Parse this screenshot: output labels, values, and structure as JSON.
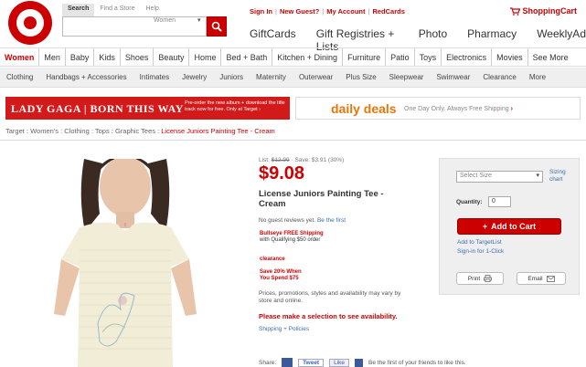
{
  "header": {
    "search_tabs": [
      "Search",
      "Find a Store",
      "Help"
    ],
    "search_placeholder": "",
    "search_scope": "Women",
    "top_links": [
      "Sign In",
      "New Guest?",
      "My Account",
      "RedCards"
    ],
    "cart_label": "ShoppingCart",
    "secondary_links": [
      "GiftCards",
      "Gift Registries + Lists",
      "Photo",
      "Pharmacy",
      "WeeklyAd"
    ]
  },
  "category_nav": {
    "items": [
      "Women",
      "Men",
      "Baby",
      "Kids",
      "Shoes",
      "Beauty",
      "Home",
      "Bed + Bath",
      "Kitchen + Dining",
      "Furniture",
      "Patio",
      "Toys",
      "Electronics",
      "Movies",
      "See More"
    ],
    "active": "Women"
  },
  "sub_nav": {
    "items": [
      "Clothing",
      "Handbags + Accessories",
      "Intimates",
      "Jewelry",
      "Juniors",
      "Maternity",
      "Outerwear",
      "Plus Size",
      "Sleepwear",
      "Swimwear",
      "Clearance",
      "More"
    ]
  },
  "banners": {
    "gaga_title": "LADY GAGA | BORN THIS WAY",
    "gaga_sub": "Pre-order the new album + download the title track now for free. Only at Target ›",
    "deals_title": "daily deals",
    "deals_sub": "One Day Only. Always Free Shipping",
    "deals_arrow": "›"
  },
  "breadcrumb": {
    "path": "Target : Women's : Clothing : Tops : Graphic Tees : ",
    "current": "License Juniors Painting Tee - Cream"
  },
  "product": {
    "list_label": "List: ",
    "list_price": "$12.99",
    "save_text": " · Save: $3.91 (30%)",
    "price": "$9.08",
    "title": "License Juniors Painting Tee - Cream",
    "reviews": "No guest reviews yet.",
    "reviews_link": "Be the first",
    "shipping_title": "Bullseye FREE Shipping",
    "shipping_sub": "with Qualifying $50 order",
    "clearance": "clearance",
    "save_offer_1": "Save 20% When",
    "save_offer_2": "You Spend $75",
    "disclaimer": "Prices, promotions, styles and availability may vary by store and online.",
    "select_msg": "Please make a selection to see availability.",
    "policies": "Shipping + Policies"
  },
  "share": {
    "label": "Share:",
    "tweet": "Tweet",
    "like": "Like",
    "like_text": "Be the first of your friends to like this."
  },
  "buybox": {
    "size_placeholder": "Select Size",
    "size_chart": "Sizing chart",
    "quantity_label": "Quantity:",
    "quantity_value": "0",
    "add_to_cart": "Add to Cart",
    "add_to_list": "Add to TargetList",
    "sign_in": "Sign-in for 1-Click",
    "print": "Print",
    "email": "Email"
  },
  "colors": {
    "brand_red": "#cc0000",
    "link_blue": "#3a6fb0"
  }
}
